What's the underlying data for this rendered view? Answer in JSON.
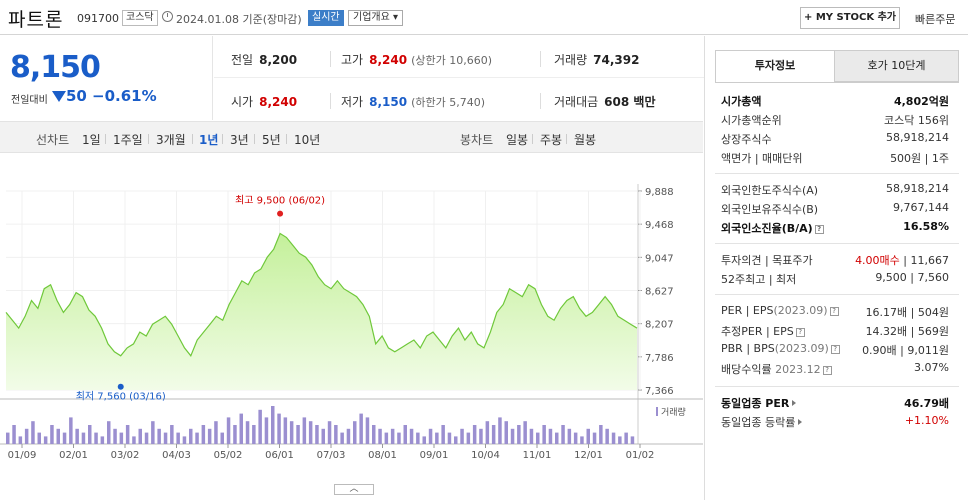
{
  "header": {
    "name": "파트론",
    "code": "091700",
    "market": "코스닥",
    "date": "2024.01.08 기준(장마감)",
    "realtime": "실시간",
    "company": "기업개요",
    "mystock": "+ MY STOCK 추가",
    "quick": "빠른주문"
  },
  "price": {
    "current": "8,150",
    "diff_label": "전일대비",
    "diff": "50",
    "pct": "−0.61%"
  },
  "quote": {
    "prev_label": "전일",
    "prev": "8,200",
    "high_label": "고가",
    "high": "8,240",
    "high_sub": "(상한가 10,660)",
    "vol_label": "거래량",
    "vol": "74,392",
    "open_label": "시가",
    "open": "8,240",
    "low_label": "저가",
    "low": "8,150",
    "low_sub": "(하한가 5,740)",
    "amt_label": "거래대금",
    "amt": "608 백만"
  },
  "period": {
    "line_title": "선차트",
    "line_items": [
      "1일",
      "1주일",
      "3개월",
      "1년",
      "3년",
      "5년",
      "10년"
    ],
    "active": "1년",
    "candle_title": "봉차트",
    "candle_items": [
      "일봉",
      "주봉",
      "월봉"
    ]
  },
  "chart_data": {
    "type": "area",
    "y_ticks": [
      "9,888",
      "9,468",
      "9,047",
      "8,627",
      "8,207",
      "7,786",
      "7,366"
    ],
    "ylim": [
      7366,
      9888
    ],
    "x_ticks": [
      "01/09",
      "02/01",
      "03/02",
      "04/03",
      "05/02",
      "06/01",
      "07/03",
      "08/01",
      "09/01",
      "10/04",
      "11/01",
      "12/01",
      "01/02"
    ],
    "max_label": "최고 9,500 (06/02)",
    "min_label": "최저 7,560 (03/16)",
    "volume_label": "거래량",
    "series": [
      {
        "values": [
          8350,
          8250,
          8150,
          8300,
          8500,
          8400,
          8650,
          8700,
          8500,
          8350,
          8450,
          8600,
          8550,
          8380,
          8300,
          8150,
          7950,
          7850,
          7800,
          7900,
          7950,
          8100,
          8050,
          8200,
          8250,
          8300,
          8200,
          8050,
          7900,
          7800,
          8000,
          8100,
          8200,
          8300,
          8250,
          8450,
          8600,
          8750,
          8700,
          8850,
          8900,
          9050,
          9150,
          9350,
          9300,
          9200,
          9100,
          9050,
          8950,
          8800,
          8700,
          8650,
          8750,
          8650,
          8600,
          8550,
          8450,
          8300,
          7950,
          8050,
          7900,
          7850,
          7900,
          7950,
          8000,
          7900,
          8050,
          8100,
          8000,
          7900,
          8050,
          8150,
          8000,
          8100,
          7950,
          7900,
          8100,
          8350,
          8450,
          8650,
          8600,
          8550,
          8700,
          8650,
          8450,
          8300,
          8250,
          8400,
          8500,
          8550,
          8400,
          8300,
          8350,
          8450,
          8550,
          8450,
          8300,
          8250,
          8200,
          8150
        ]
      }
    ],
    "volume": [
      0.3,
      0.5,
      0.2,
      0.4,
      0.6,
      0.3,
      0.2,
      0.5,
      0.4,
      0.3,
      0.7,
      0.4,
      0.3,
      0.5,
      0.3,
      0.2,
      0.6,
      0.4,
      0.3,
      0.5,
      0.2,
      0.4,
      0.3,
      0.6,
      0.4,
      0.3,
      0.5,
      0.3,
      0.2,
      0.4,
      0.3,
      0.5,
      0.4,
      0.6,
      0.3,
      0.7,
      0.5,
      0.8,
      0.6,
      0.5,
      0.9,
      0.7,
      1.0,
      0.8,
      0.7,
      0.6,
      0.5,
      0.7,
      0.6,
      0.5,
      0.4,
      0.6,
      0.5,
      0.3,
      0.4,
      0.6,
      0.8,
      0.7,
      0.5,
      0.4,
      0.3,
      0.4,
      0.3,
      0.5,
      0.4,
      0.3,
      0.2,
      0.4,
      0.3,
      0.5,
      0.3,
      0.2,
      0.4,
      0.3,
      0.5,
      0.4,
      0.6,
      0.5,
      0.7,
      0.6,
      0.4,
      0.5,
      0.6,
      0.4,
      0.3,
      0.5,
      0.4,
      0.3,
      0.5,
      0.4,
      0.3,
      0.2,
      0.4,
      0.3,
      0.5,
      0.4,
      0.3,
      0.2,
      0.3,
      0.2
    ]
  },
  "panel": {
    "tab1": "투자정보",
    "tab2": "호가 10단계",
    "mcap_label": "시가총액",
    "mcap": "4,802억원",
    "rank_label": "시가총액순위",
    "rank": "코스닥 156위",
    "shares_label": "상장주식수",
    "shares": "58,918,214",
    "par_label": "액면가 | 매매단위",
    "par": "500원 | 1주",
    "flimit_label": "외국인한도주식수(A)",
    "flimit": "58,918,214",
    "fhold_label": "외국인보유주식수(B)",
    "fhold": "9,767,144",
    "frate_label": "외국인소진율(B/A)",
    "frate": "16.58%",
    "opinion_label": "투자의견 | 목표주가",
    "opinion": "4.00매수",
    "target": "11,667",
    "w52_label": "52주최고 | 최저",
    "w52": "9,500 | 7,560",
    "per_label": "PER | EPS",
    "per_year": "(2023.09)",
    "per": "16.17배 | 504원",
    "eper_label": "추정PER | EPS",
    "eper": "14.32배 | 569원",
    "pbr_label": "PBR | BPS",
    "pbr_year": "(2023.09)",
    "pbr": "0.90배 | 9,011원",
    "div_label": "배당수익률",
    "div_year": "2023.12",
    "div": "3.07%",
    "iper_label": "동일업종 PER",
    "iper": "46.79배",
    "ichg_label": "동일업종 등락률",
    "ichg": "+1.10%"
  }
}
